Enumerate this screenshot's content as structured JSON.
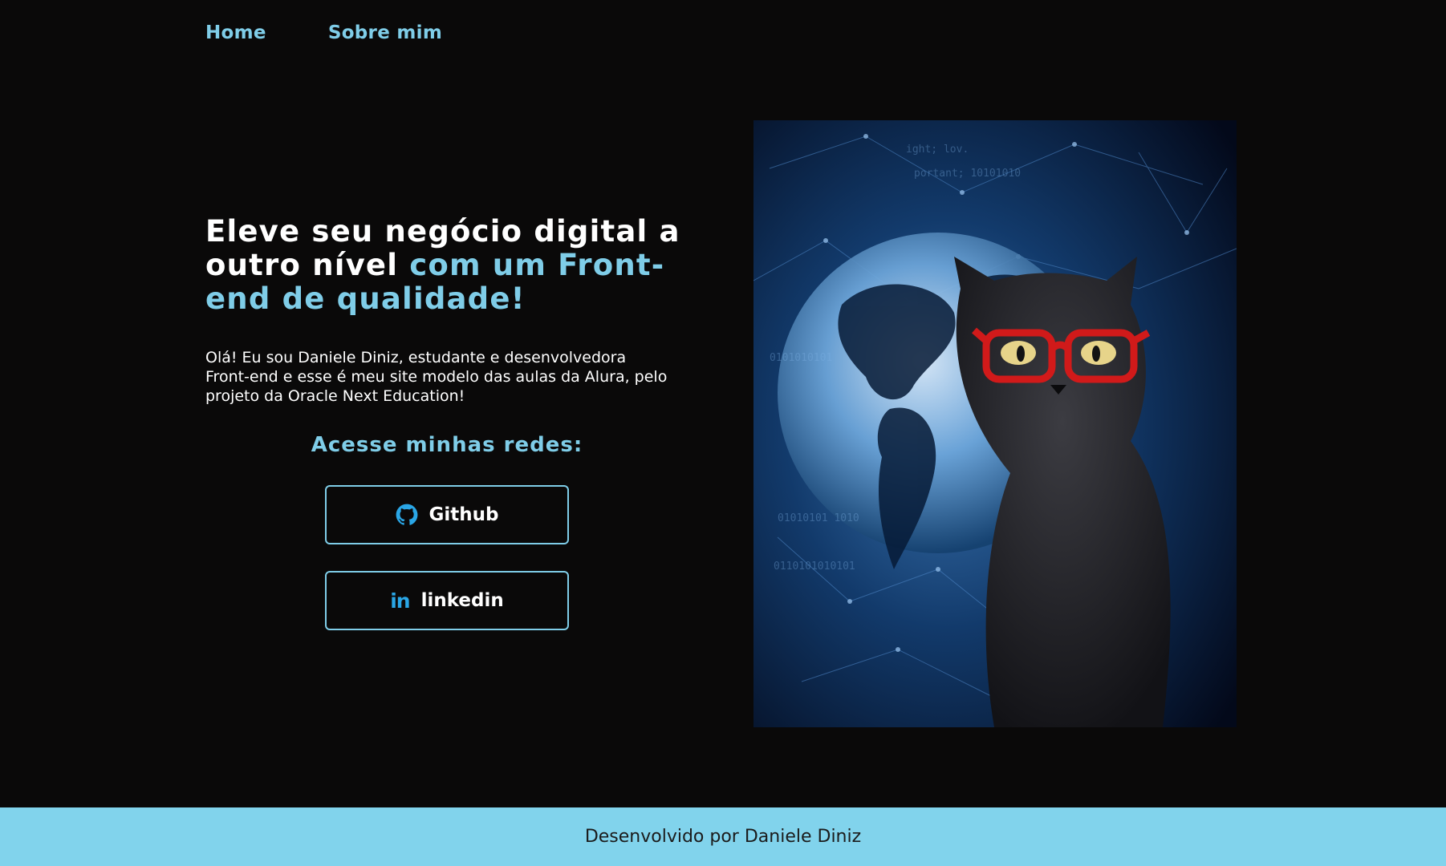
{
  "nav": {
    "items": [
      "Home",
      "Sobre mim"
    ]
  },
  "hero": {
    "headline_white": "Eleve seu negócio digital a outro nível",
    "headline_accent": "com um Front-end de qualidade!",
    "intro": "Olá! Eu sou Daniele Diniz, estudante e desenvolvedora Front-end e esse é meu site modelo das aulas da Alura, pelo projeto da Oracle Next Education!"
  },
  "social": {
    "title": "Acesse minhas redes:",
    "buttons": [
      {
        "label": "Github",
        "icon": "github-icon"
      },
      {
        "label": "linkedin",
        "icon": "linkedin-icon",
        "glyph": "in"
      }
    ]
  },
  "image": {
    "subject": "black cat with red glasses over digital globe"
  },
  "footer": {
    "text": "Desenvolvido por Daniele Diniz"
  },
  "colors": {
    "background": "#0a0909",
    "accent": "#7fcde8",
    "footer_bg": "#81d3ec",
    "text": "#ffffff"
  }
}
